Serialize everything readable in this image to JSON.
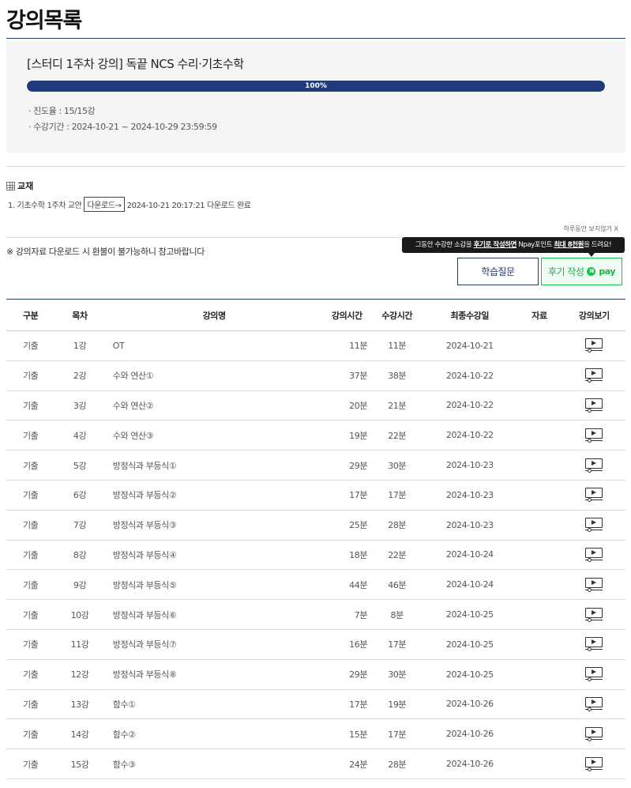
{
  "page": {
    "title": "강의목록"
  },
  "course": {
    "title": "[스터디 1주차 강의] 독끝 NCS 수리·기초수학",
    "progress": {
      "value": 1.0,
      "label": "100%"
    },
    "progress_rate": "· 진도율 : 15/15강",
    "period": "· 수강기간 : 2024-10-21 ~ 2024-10-29 23:59:59"
  },
  "textbook": {
    "heading": "교재",
    "name": "1. 기초수학 1주차 교안",
    "download_label": "다운로드→",
    "status": "2024-10-21 20:17:21 다운로드 완료"
  },
  "hide_today": "하루동안 보지않기 X",
  "notice": "※ 강의자료 다운로드 시 환불이 불가능하니 참고바랍니다",
  "tooltip": {
    "prefix": "그동안 수강한 소감을 ",
    "link": "후기로 작성하면",
    "middle": " Npay포인트 ",
    "highlight": "최대 8천원",
    "suffix": "을 드려요!"
  },
  "buttons": {
    "question": "학습질문",
    "review": "후기 작성",
    "npay_badge": "N",
    "npay_text": "pay"
  },
  "table": {
    "headers": {
      "type": "구분",
      "number": "목차",
      "name": "강의명",
      "duration": "강의시간",
      "watched": "수강시간",
      "last_date": "최종수강일",
      "material": "자료",
      "view": "강의보기"
    },
    "rows": [
      {
        "type": "기출",
        "number": "1강",
        "name": "OT",
        "duration": "11분",
        "watched": "11분",
        "last_date": "2024-10-21",
        "material": ""
      },
      {
        "type": "기출",
        "number": "2강",
        "name": "수와 연산①",
        "duration": "37분",
        "watched": "38분",
        "last_date": "2024-10-22",
        "material": ""
      },
      {
        "type": "기출",
        "number": "3강",
        "name": "수와 연산②",
        "duration": "20분",
        "watched": "21분",
        "last_date": "2024-10-22",
        "material": ""
      },
      {
        "type": "기출",
        "number": "4강",
        "name": "수와 연산③",
        "duration": "19분",
        "watched": "22분",
        "last_date": "2024-10-22",
        "material": ""
      },
      {
        "type": "기출",
        "number": "5강",
        "name": "방정식과 부등식①",
        "duration": "29분",
        "watched": "30분",
        "last_date": "2024-10-23",
        "material": ""
      },
      {
        "type": "기출",
        "number": "6강",
        "name": "방정식과 부등식②",
        "duration": "17분",
        "watched": "17분",
        "last_date": "2024-10-23",
        "material": ""
      },
      {
        "type": "기출",
        "number": "7강",
        "name": "방정식과 부등식③",
        "duration": "25분",
        "watched": "28분",
        "last_date": "2024-10-23",
        "material": ""
      },
      {
        "type": "기출",
        "number": "8강",
        "name": "방정식과 부등식④",
        "duration": "18분",
        "watched": "22분",
        "last_date": "2024-10-24",
        "material": ""
      },
      {
        "type": "기출",
        "number": "9강",
        "name": "방정식과 부등식⑤",
        "duration": "44분",
        "watched": "46분",
        "last_date": "2024-10-24",
        "material": ""
      },
      {
        "type": "기출",
        "number": "10강",
        "name": "방정식과 부등식⑥",
        "duration": "7분",
        "watched": "8분",
        "last_date": "2024-10-25",
        "material": ""
      },
      {
        "type": "기출",
        "number": "11강",
        "name": "방정식과 부등식⑦",
        "duration": "16분",
        "watched": "17분",
        "last_date": "2024-10-25",
        "material": ""
      },
      {
        "type": "기출",
        "number": "12강",
        "name": "방정식과 부등식⑧",
        "duration": "29분",
        "watched": "30분",
        "last_date": "2024-10-25",
        "material": ""
      },
      {
        "type": "기출",
        "number": "13강",
        "name": "함수①",
        "duration": "17분",
        "watched": "19분",
        "last_date": "2024-10-26",
        "material": ""
      },
      {
        "type": "기출",
        "number": "14강",
        "name": "함수②",
        "duration": "15분",
        "watched": "17분",
        "last_date": "2024-10-26",
        "material": ""
      },
      {
        "type": "기출",
        "number": "15강",
        "name": "함수③",
        "duration": "24분",
        "watched": "28분",
        "last_date": "2024-10-26",
        "material": ""
      }
    ]
  },
  "colors": {
    "accent": "#1e3a7b",
    "npay_green": "#19c24c"
  },
  "icons": {
    "play": "video-play-icon",
    "table": "table-grid-icon"
  }
}
